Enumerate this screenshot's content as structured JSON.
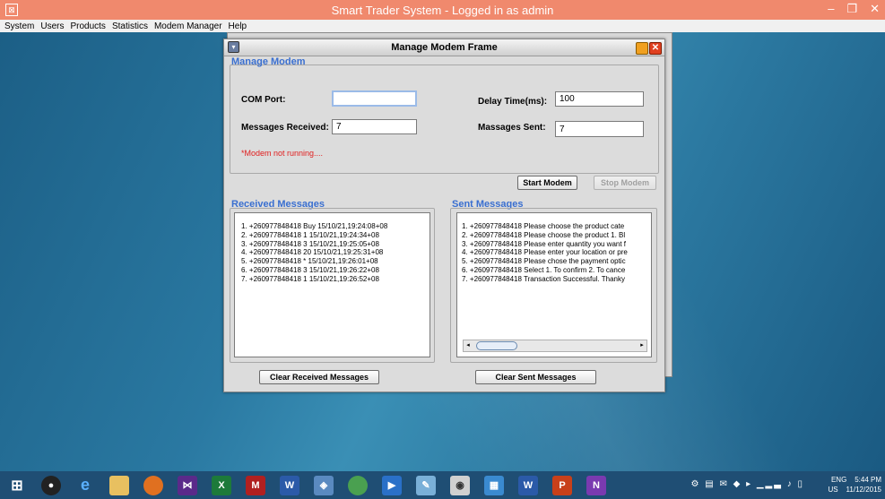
{
  "app": {
    "title": "Smart Trader System - Logged in as admin",
    "menu": [
      "System",
      "Users",
      "Products",
      "Statistics",
      "Modem Manager",
      "Help"
    ]
  },
  "frame": {
    "title": "Manage Modem Frame",
    "manage_group_title": "Manage Modem",
    "com_port_label": "COM Port:",
    "com_port_value": "",
    "messages_received_label": "Messages Received:",
    "messages_received_value": "7",
    "delay_label": "Delay Time(ms):",
    "delay_value": "100",
    "messages_sent_label": "Massages Sent:",
    "messages_sent_value": "7",
    "status": "*Modem not running....",
    "start_button": "Start Modem",
    "stop_button": "Stop Modem",
    "received_title": "Received Messages",
    "sent_title": "Sent Messages",
    "received_messages": [
      "1. +260977848418 Buy 15/10/21,19:24:08+08",
      "2. +260977848418 1 15/10/21,19:24:34+08",
      "3. +260977848418 3 15/10/21,19:25:05+08",
      "4. +260977848418 20 15/10/21,19:25:31+08",
      "5. +260977848418 * 15/10/21,19:26:01+08",
      "6. +260977848418 3 15/10/21,19:26:22+08",
      "7. +260977848418 1 15/10/21,19:26:52+08"
    ],
    "sent_messages": [
      "1. +260977848418 Please choose the product cate",
      "2. +260977848418 Please choose the product 1. Bl",
      "3. +260977848418 Please enter quantity you want f",
      "4. +260977848418 Please enter your location or pre",
      "5. +260977848418 Please chose the payment optic",
      "6. +260977848418 Select 1. To confirm  2. To cance",
      "7. +260977848418 Transaction Successful. Thanky"
    ],
    "clear_received_button": "Clear Received Messages",
    "clear_sent_button": "Clear Sent Messages"
  },
  "tray": {
    "language": "ENG",
    "region": "US",
    "time": "5:44 PM",
    "date": "11/12/2015"
  },
  "colors": {
    "titlebar": "#f0896d",
    "group_title": "#3a6fd0",
    "status": "#e02020",
    "taskbar": "#1f4e74"
  }
}
